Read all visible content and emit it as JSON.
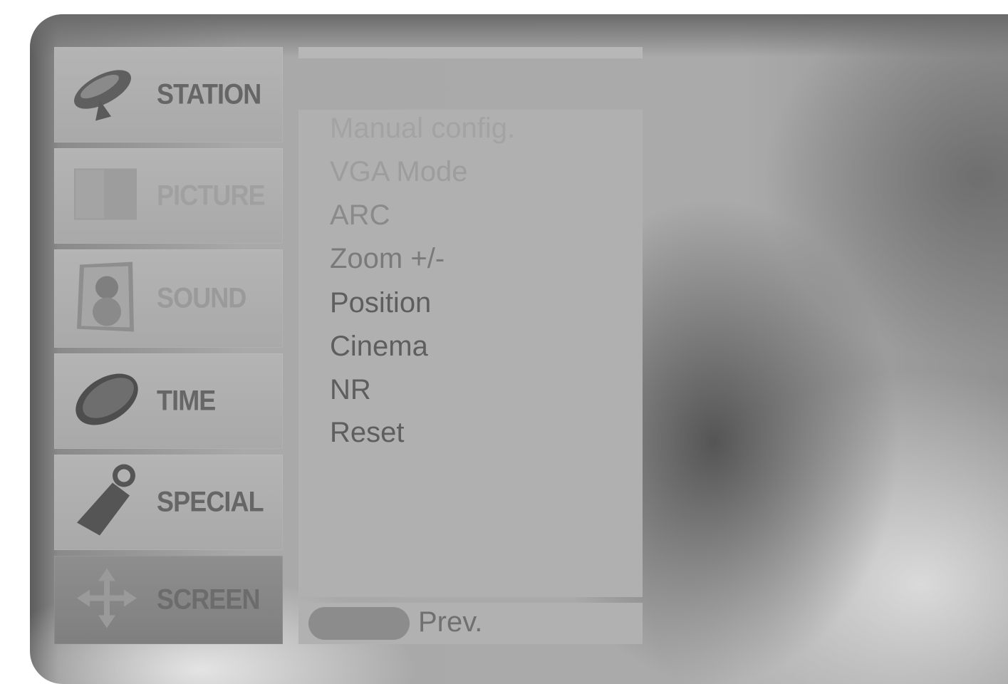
{
  "sidebar": {
    "items": [
      {
        "label": "STATION",
        "icon": "satellite-dish-icon"
      },
      {
        "label": "PICTURE",
        "icon": "picture-icon"
      },
      {
        "label": "SOUND",
        "icon": "speaker-icon"
      },
      {
        "label": "TIME",
        "icon": "clock-icon"
      },
      {
        "label": "SPECIAL",
        "icon": "tag-icon"
      },
      {
        "label": "SCREEN",
        "icon": "move-arrows-icon",
        "active": true
      }
    ]
  },
  "menu": {
    "items": [
      "Manual config.",
      "VGA Mode",
      "ARC",
      "Zoom +/-",
      "Position",
      "Cinema",
      "NR",
      "Reset"
    ]
  },
  "footer": {
    "prev_label": "Prev."
  },
  "colors": {
    "panel": "#b0b0b0",
    "active_tile": "#858585",
    "text": "#5e5e5e"
  }
}
